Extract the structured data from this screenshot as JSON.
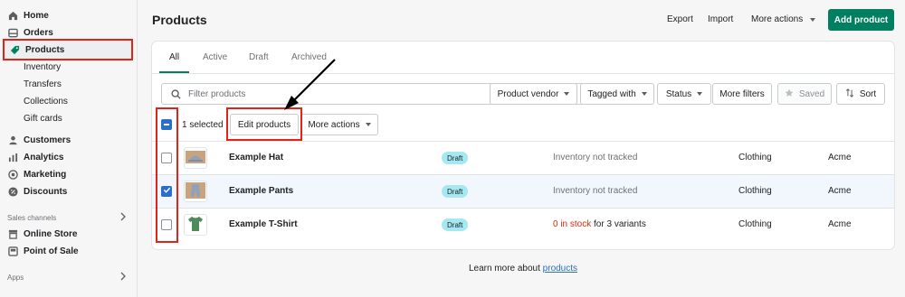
{
  "sidebar": {
    "main": [
      {
        "label": "Home",
        "icon": "home-icon"
      },
      {
        "label": "Orders",
        "icon": "orders-icon"
      },
      {
        "label": "Products",
        "icon": "tag-icon",
        "active": true
      }
    ],
    "products_sub": [
      "Inventory",
      "Transfers",
      "Collections",
      "Gift cards"
    ],
    "more": [
      {
        "label": "Customers",
        "icon": "person-icon"
      },
      {
        "label": "Analytics",
        "icon": "bar-chart-icon"
      },
      {
        "label": "Marketing",
        "icon": "target-icon"
      },
      {
        "label": "Discounts",
        "icon": "discount-icon"
      }
    ],
    "sales_channels_label": "Sales channels",
    "channels": [
      {
        "label": "Online Store",
        "icon": "store-icon"
      },
      {
        "label": "Point of Sale",
        "icon": "pos-icon"
      }
    ],
    "apps_label": "Apps"
  },
  "header": {
    "title": "Products",
    "export_label": "Export",
    "import_label": "Import",
    "more_actions_label": "More actions",
    "add_product_label": "Add product"
  },
  "tabs": [
    "All",
    "Active",
    "Draft",
    "Archived"
  ],
  "filters": {
    "search_placeholder": "Filter products",
    "product_vendor": "Product vendor",
    "tagged_with": "Tagged with",
    "status": "Status",
    "more_filters": "More filters",
    "saved": "Saved",
    "sort": "Sort"
  },
  "bulk": {
    "selected_text": "1 selected",
    "edit_products": "Edit products",
    "more_actions": "More actions"
  },
  "products": [
    {
      "name": "Example Hat",
      "status": "Draft",
      "inventory": "Inventory not tracked",
      "inventory_red": "",
      "inventory_rest": "",
      "type": "Clothing",
      "vendor": "Acme",
      "checked": false
    },
    {
      "name": "Example Pants",
      "status": "Draft",
      "inventory": "Inventory not tracked",
      "inventory_red": "",
      "inventory_rest": "",
      "type": "Clothing",
      "vendor": "Acme",
      "checked": true
    },
    {
      "name": "Example T-Shirt",
      "status": "Draft",
      "inventory": "",
      "inventory_red": "0 in stock",
      "inventory_rest": " for 3 variants",
      "type": "Clothing",
      "vendor": "Acme",
      "checked": false
    }
  ],
  "footer": {
    "text": "Learn more about ",
    "link": "products"
  },
  "colors": {
    "primary": "#008060",
    "annotation_red": "#e0231b",
    "checkbox_blue": "#2c6ecb",
    "draft_badge": "#a4e8f2"
  }
}
